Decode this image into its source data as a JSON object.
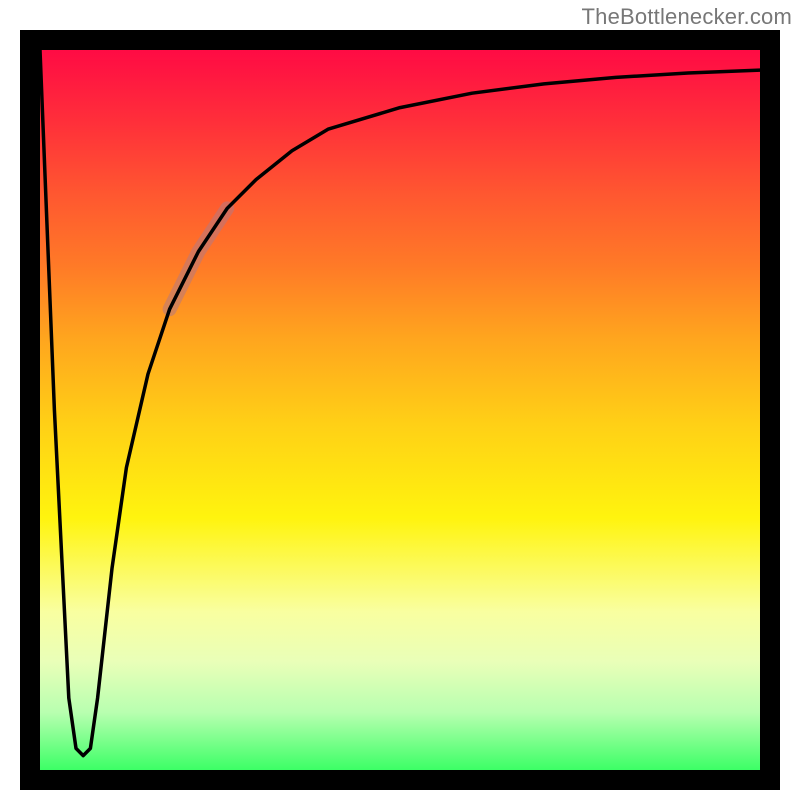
{
  "watermark": "TheBottleneсker.com",
  "plot": {
    "frame_color": "#000000",
    "frame_thickness_px": 20,
    "inner_size_px": 720
  },
  "chart_data": {
    "type": "line",
    "title": "",
    "xlabel": "",
    "ylabel": "",
    "xlim": [
      0,
      100
    ],
    "ylim": [
      0,
      100
    ],
    "grid": false,
    "legend_position": "none",
    "series": [
      {
        "name": "bottleneck-curve",
        "x": [
          0,
          2,
          4,
          5,
          6,
          7,
          8,
          10,
          12,
          15,
          18,
          22,
          26,
          30,
          35,
          40,
          50,
          60,
          70,
          80,
          90,
          100
        ],
        "y": [
          100,
          50,
          10,
          3,
          2,
          3,
          10,
          28,
          42,
          55,
          64,
          72,
          78,
          82,
          86,
          89,
          92,
          94,
          95.3,
          96.2,
          96.8,
          97.2
        ]
      }
    ],
    "annotations": [
      {
        "name": "highlight-segment",
        "x_range": [
          18,
          26
        ],
        "y_range": [
          64,
          78
        ],
        "style": "thick-translucent-pink"
      }
    ],
    "gradient_stops": [
      {
        "pos": 0.0,
        "color": "#ff0b44"
      },
      {
        "pos": 0.5,
        "color": "#ffd016"
      },
      {
        "pos": 0.78,
        "color": "#f9ffa0"
      },
      {
        "pos": 1.0,
        "color": "#3cff66"
      }
    ]
  }
}
